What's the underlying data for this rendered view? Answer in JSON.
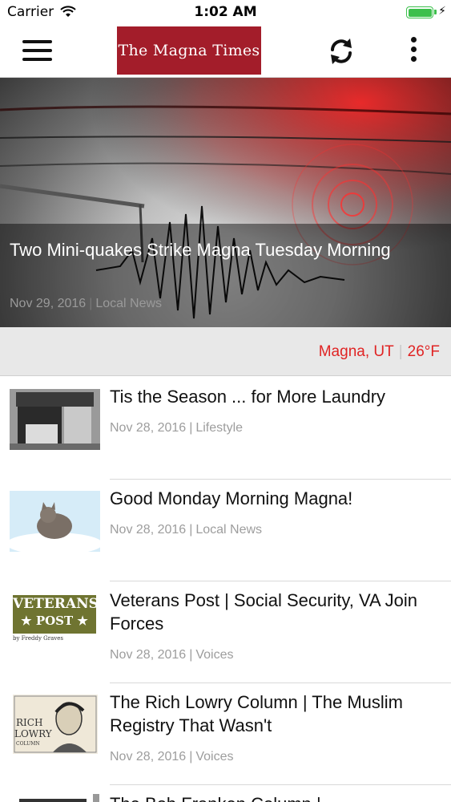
{
  "status_bar": {
    "carrier": "Carrier",
    "time": "1:02 AM"
  },
  "nav": {
    "logo_text": "The Magna Times"
  },
  "hero": {
    "title": "Two Mini-quakes Strike Magna Tuesday Morning",
    "date": "Nov 29, 2016",
    "category": "Local News"
  },
  "weather": {
    "location": "Magna, UT",
    "temperature": "26°F"
  },
  "articles": [
    {
      "headline": "Tis the Season ... for More Laundry",
      "date": "Nov 28, 2016",
      "category": "Lifestyle"
    },
    {
      "headline": "Good Monday Morning Magna!",
      "date": "Nov 28, 2016",
      "category": "Local News"
    },
    {
      "headline": "Veterans Post | Social Security, VA Join Forces",
      "date": "Nov 28, 2016",
      "category": "Voices",
      "thumb_text": {
        "line1": "VETERANS",
        "line2": "★ POST ★",
        "byline": "by Freddy Graves"
      }
    },
    {
      "headline": "The Rich Lowry Column | The Muslim Registry That Wasn't",
      "date": "Nov 28, 2016",
      "category": "Voices",
      "thumb_text": {
        "line1": "RICH",
        "line2": "LOWRY",
        "line3": "COLUMN"
      }
    },
    {
      "headline": "The Bob Franken Column |",
      "date": "",
      "category": ""
    }
  ],
  "colors": {
    "logo_bg": "#a31d2a",
    "weather_text": "#e02424",
    "battery": "#3cc04c"
  }
}
